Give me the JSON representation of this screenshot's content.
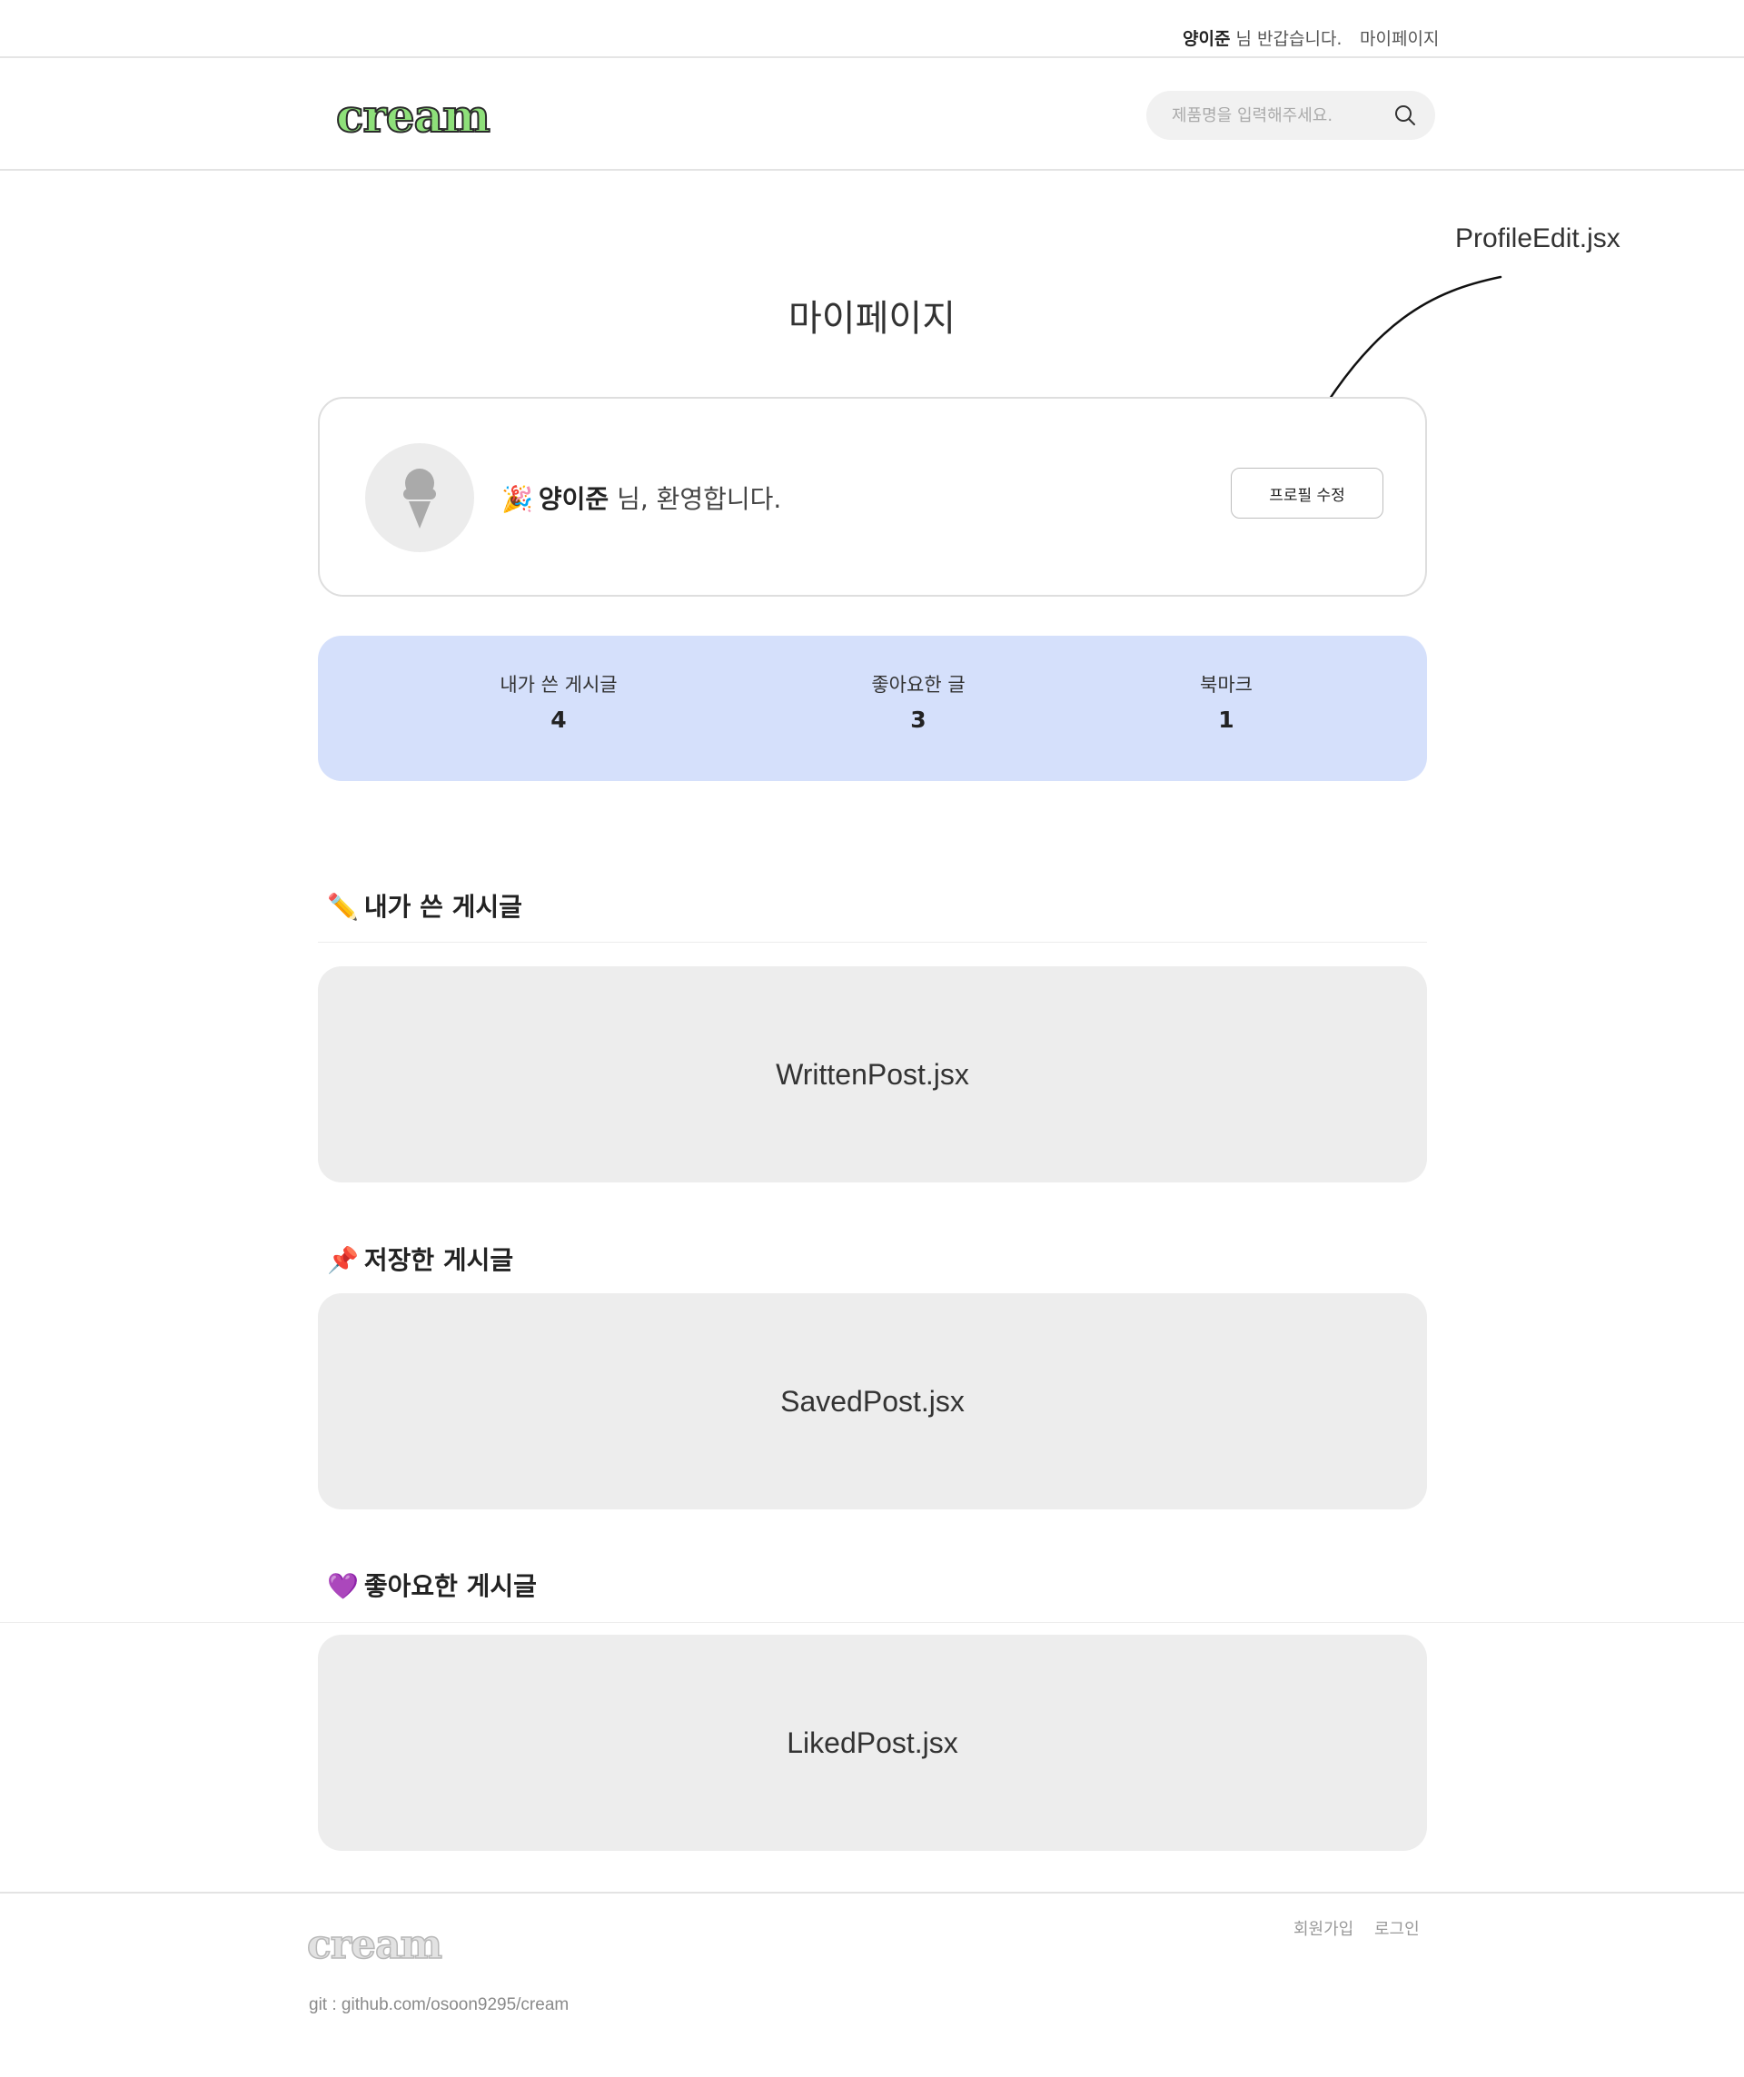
{
  "topbar": {
    "user_name": "양이준",
    "greeting_suffix": "님 반갑습니다.",
    "mypage_link": "마이페이지"
  },
  "header": {
    "logo": "cream",
    "search": {
      "placeholder": "제품명을 입력해주세요.",
      "value": ""
    },
    "search_icon": "search-icon"
  },
  "annotation": {
    "label": "ProfileEdit.jsx"
  },
  "page": {
    "title": "마이페이지"
  },
  "profile": {
    "avatar_icon": "ice-cream-icon",
    "welcome_emoji": "🎉",
    "user_name": "양이준",
    "welcome_suffix": "님, 환영합니다.",
    "edit_button": "프로필 수정"
  },
  "stats": [
    {
      "label": "내가 쓴 게시글",
      "value": "4"
    },
    {
      "label": "좋아요한 글",
      "value": "3"
    },
    {
      "label": "북마크",
      "value": "1"
    }
  ],
  "sections": [
    {
      "emoji": "✏️",
      "title": "내가 쓴 게시글",
      "placeholder": "WrittenPost.jsx"
    },
    {
      "emoji": "📌",
      "title": "저장한 게시글",
      "placeholder": "SavedPost.jsx"
    },
    {
      "emoji": "💜",
      "title": "좋아요한 게시글",
      "placeholder": "LikedPost.jsx"
    }
  ],
  "footer": {
    "logo": "cream",
    "signup_link": "회원가입",
    "login_link": "로그인",
    "git": "git : github.com/osoon9295/cream"
  },
  "colors": {
    "logo_green": "#8ee07a",
    "stats_bg": "#d5e0fb",
    "placeholder_bg": "#ededed"
  }
}
